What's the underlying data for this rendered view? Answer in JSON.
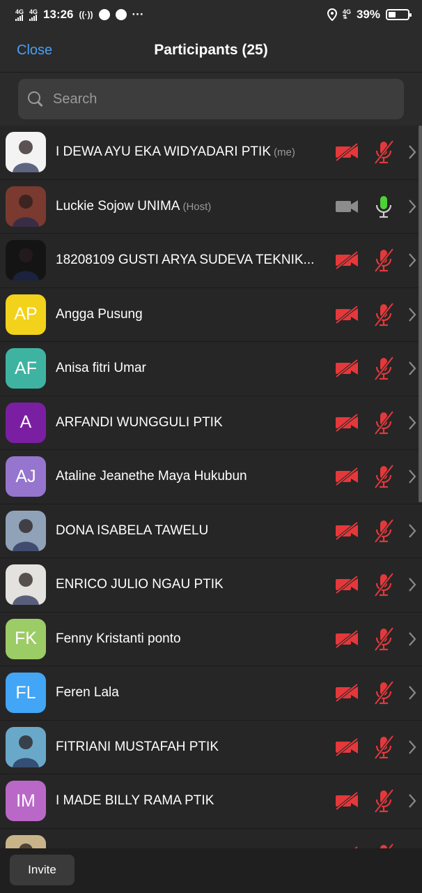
{
  "status_bar": {
    "network1": "4G",
    "network2": "4G",
    "time": "13:26",
    "more": "···",
    "network_right": "4G",
    "battery": "39%",
    "battery_level": 0.39
  },
  "header": {
    "close_label": "Close",
    "title": "Participants (25)"
  },
  "search": {
    "placeholder": "Search"
  },
  "colors": {
    "accent": "#4a9ff5",
    "muted_red": "#e5383b",
    "active_green": "#4cd137"
  },
  "participants": [
    {
      "name": "I DEWA AYU EKA WIDYADARI PTIK",
      "tag": "(me)",
      "avatar_type": "photo",
      "avatar_bg": "#f3f3f3",
      "initials": "",
      "video": "off",
      "audio": "muted"
    },
    {
      "name": "Luckie Sojow UNIMA",
      "tag": "(Host)",
      "avatar_type": "photo",
      "avatar_bg": "#7a3a2f",
      "initials": "",
      "video": "idle",
      "audio": "active"
    },
    {
      "name": "18208109 GUSTI ARYA SUDEVA TEKNIK...",
      "tag": "",
      "avatar_type": "photo",
      "avatar_bg": "#141414",
      "initials": "",
      "video": "off",
      "audio": "muted"
    },
    {
      "name": "Angga Pusung",
      "tag": "",
      "avatar_type": "initials",
      "avatar_bg": "#f2d21b",
      "initials": "AP",
      "video": "off",
      "audio": "muted"
    },
    {
      "name": "Anisa fitri Umar",
      "tag": "",
      "avatar_type": "initials",
      "avatar_bg": "#3fb3a2",
      "initials": "AF",
      "video": "off",
      "audio": "muted"
    },
    {
      "name": "ARFANDI WUNGGULI PTIK",
      "tag": "",
      "avatar_type": "initials",
      "avatar_bg": "#7b1fa2",
      "initials": "A",
      "video": "off",
      "audio": "muted"
    },
    {
      "name": "Ataline Jeanethe Maya Hukubun",
      "tag": "",
      "avatar_type": "initials",
      "avatar_bg": "#9575cd",
      "initials": "AJ",
      "video": "off",
      "audio": "muted"
    },
    {
      "name": "DONA ISABELA TAWELU",
      "tag": "",
      "avatar_type": "photo",
      "avatar_bg": "#8fa2b8",
      "initials": "",
      "video": "off",
      "audio": "muted"
    },
    {
      "name": "ENRICO JULIO NGAU PTIK",
      "tag": "",
      "avatar_type": "photo",
      "avatar_bg": "#e4e2de",
      "initials": "",
      "video": "off",
      "audio": "muted"
    },
    {
      "name": "Fenny Kristanti ponto",
      "tag": "",
      "avatar_type": "initials",
      "avatar_bg": "#9ccc65",
      "initials": "FK",
      "video": "off",
      "audio": "muted"
    },
    {
      "name": "Feren Lala",
      "tag": "",
      "avatar_type": "initials",
      "avatar_bg": "#42a5f5",
      "initials": "FL",
      "video": "off",
      "audio": "muted"
    },
    {
      "name": "FITRIANI MUSTAFAH PTIK",
      "tag": "",
      "avatar_type": "photo",
      "avatar_bg": "#6aa8c9",
      "initials": "",
      "video": "off",
      "audio": "muted"
    },
    {
      "name": "I MADE BILLY RAMA PTIK",
      "tag": "",
      "avatar_type": "initials",
      "avatar_bg": "#ba68c8",
      "initials": "IM",
      "video": "off",
      "audio": "muted"
    },
    {
      "name": "",
      "tag": "",
      "avatar_type": "photo",
      "avatar_bg": "#c9b48a",
      "initials": "",
      "video": "off",
      "audio": "muted"
    }
  ],
  "bottom_bar": {
    "invite_label": "Invite"
  }
}
